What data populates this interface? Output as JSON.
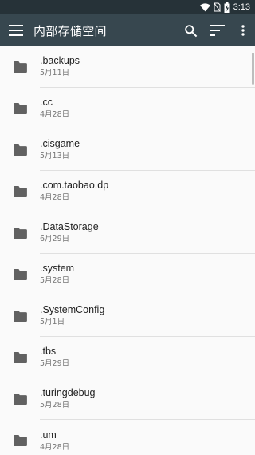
{
  "status": {
    "time": "3:13",
    "wifi_icon": "wifi-icon",
    "no_sim_icon": "no-sim-icon",
    "battery_icon": "battery-charging-icon"
  },
  "appbar": {
    "title": "内部存储空间",
    "menu_icon": "menu-icon",
    "search_icon": "search-icon",
    "sort_icon": "sort-icon",
    "more_icon": "more-vert-icon"
  },
  "colors": {
    "statusbar": "#263238",
    "appbar": "#37474f",
    "folder_icon": "#616161"
  },
  "files": [
    {
      "name": ".backups",
      "date": "5月11日"
    },
    {
      "name": ".cc",
      "date": "4月28日"
    },
    {
      "name": ".cisgame",
      "date": "5月13日"
    },
    {
      "name": ".com.taobao.dp",
      "date": "4月28日"
    },
    {
      "name": ".DataStorage",
      "date": "6月29日"
    },
    {
      "name": ".system",
      "date": "5月28日"
    },
    {
      "name": ".SystemConfig",
      "date": "5月1日"
    },
    {
      "name": ".tbs",
      "date": "5月29日"
    },
    {
      "name": ".turingdebug",
      "date": "5月28日"
    },
    {
      "name": ".um",
      "date": "4月28日"
    }
  ]
}
